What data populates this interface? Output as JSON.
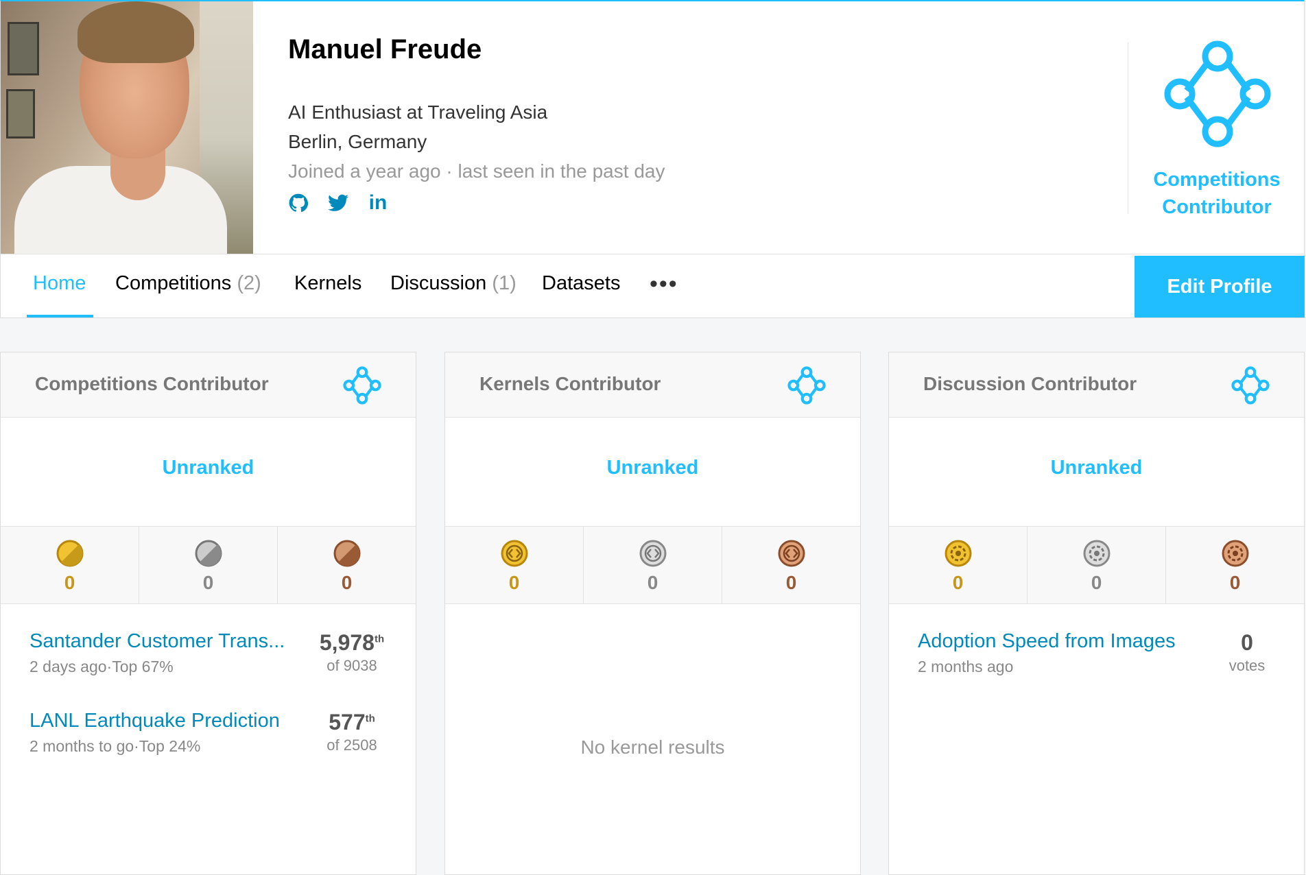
{
  "profile": {
    "name": "Manuel Freude",
    "occupation": "AI Enthusiast at Traveling Asia",
    "location": "Berlin, Germany",
    "joined": "Joined a year ago · last seen in the past day",
    "socials": [
      {
        "icon": "github-icon"
      },
      {
        "icon": "twitter-icon"
      },
      {
        "icon": "linkedin-icon",
        "label": "in"
      }
    ],
    "tier": {
      "label_line1": "Competitions",
      "label_line2": "Contributor"
    }
  },
  "nav": {
    "tabs": [
      {
        "label": "Home",
        "count": ""
      },
      {
        "label": "Competitions",
        "count": "(2)"
      },
      {
        "label": "Kernels",
        "count": ""
      },
      {
        "label": "Discussion",
        "count": "(1)"
      },
      {
        "label": "Datasets",
        "count": ""
      }
    ],
    "active_tab": "Home",
    "more": "•••",
    "edit_profile": "Edit Profile"
  },
  "cards": {
    "competitions": {
      "title": "Competitions Contributor",
      "rank": "Unranked",
      "medals": {
        "gold": "0",
        "silver": "0",
        "bronze": "0"
      },
      "entries": [
        {
          "title": "Santander Customer Trans...",
          "sub": "2 days ago·Top 67%",
          "rank": "5,978",
          "suffix": "th",
          "of": "of 9038"
        },
        {
          "title": "LANL Earthquake Prediction",
          "sub": "2 months to go·Top 24%",
          "rank": "577",
          "suffix": "th",
          "of": "of 2508"
        }
      ]
    },
    "kernels": {
      "title": "Kernels Contributor",
      "rank": "Unranked",
      "medals": {
        "gold": "0",
        "silver": "0",
        "bronze": "0"
      },
      "empty": "No kernel results"
    },
    "discussion": {
      "title": "Discussion Contributor",
      "rank": "Unranked",
      "medals": {
        "gold": "0",
        "silver": "0",
        "bronze": "0"
      },
      "entries": [
        {
          "title": "Adoption Speed from Images",
          "sub": "2 months ago",
          "votes": "0",
          "votes_label": "votes"
        }
      ]
    }
  },
  "colors": {
    "accent": "#20beff",
    "link": "#008abc",
    "gold": "#c7961b",
    "silver": "#888888",
    "bronze": "#9a5a35"
  }
}
